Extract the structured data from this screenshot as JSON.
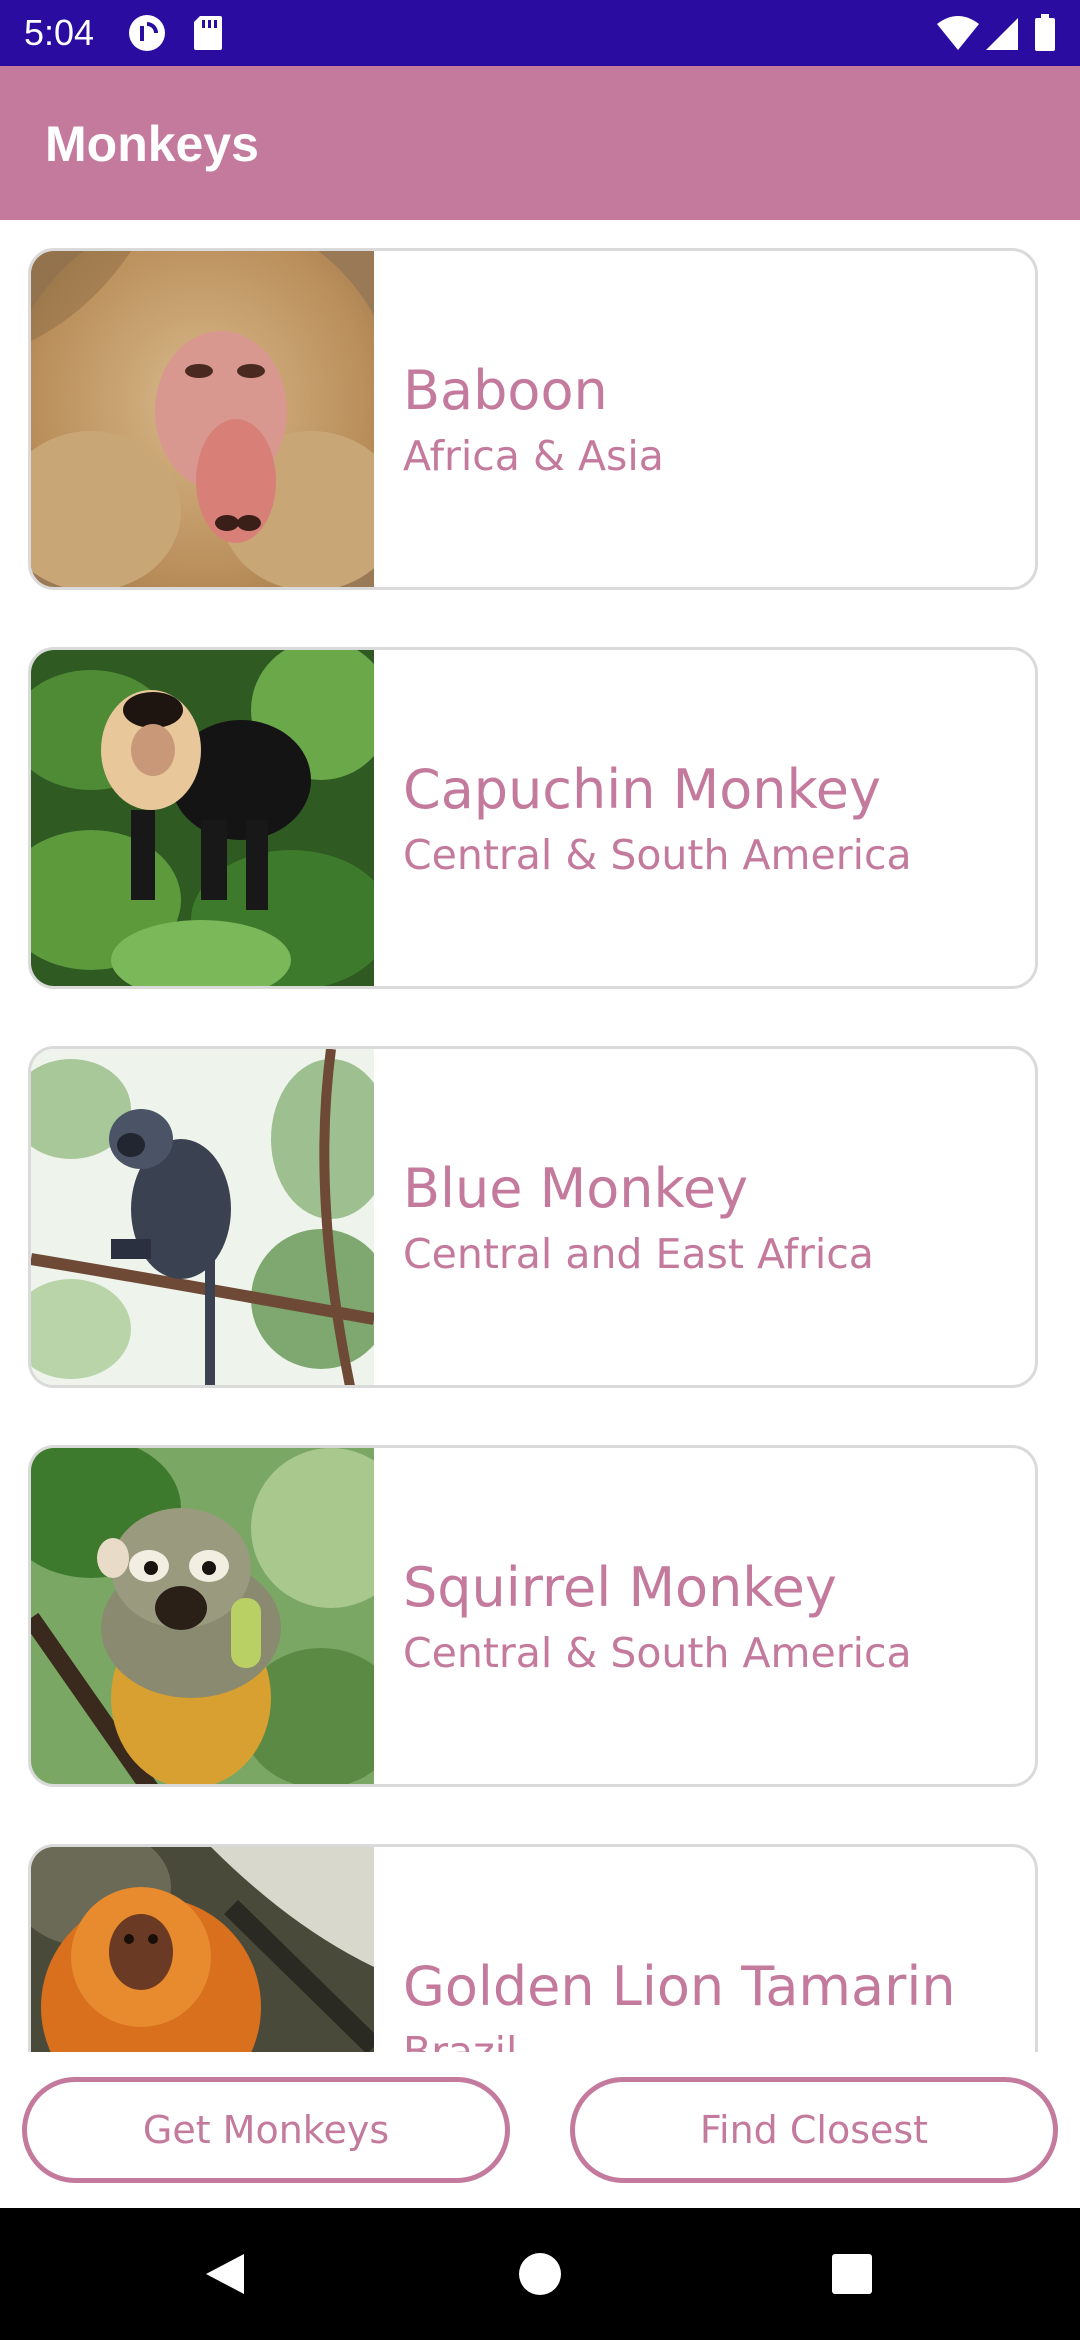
{
  "status_bar": {
    "time": "5:04",
    "icons": [
      "pocket-casts-icon",
      "sd-card-icon",
      "wifi-icon",
      "cell-signal-icon",
      "battery-icon"
    ]
  },
  "app_bar": {
    "title": "Monkeys"
  },
  "monkeys": [
    {
      "name": "Baboon",
      "location": "Africa & Asia",
      "image": "baboon-photo"
    },
    {
      "name": "Capuchin Monkey",
      "location": "Central & South America",
      "image": "capuchin-monkey-photo"
    },
    {
      "name": "Blue Monkey",
      "location": "Central and East Africa",
      "image": "blue-monkey-photo"
    },
    {
      "name": "Squirrel Monkey",
      "location": "Central & South America",
      "image": "squirrel-monkey-photo"
    },
    {
      "name": "Golden Lion Tamarin",
      "location": "Brazil",
      "image": "golden-lion-tamarin-photo"
    }
  ],
  "buttons": {
    "get_monkeys": "Get Monkeys",
    "find_closest": "Find Closest"
  },
  "nav_bar": {
    "icons": [
      "back-icon",
      "home-icon",
      "recents-icon"
    ]
  },
  "colors": {
    "status_bar": "#2a0ca0",
    "app_bar": "#c47a9c",
    "accent_text": "#c47a9c",
    "card_border": "#dadada"
  }
}
